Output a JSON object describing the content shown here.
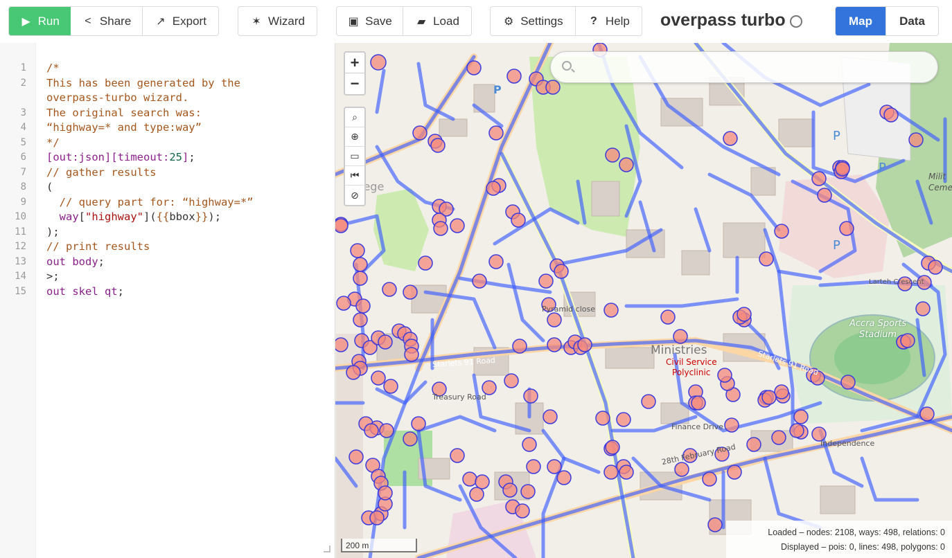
{
  "toolbar": {
    "run": "Run",
    "share": "Share",
    "export": "Export",
    "wizard": "Wizard",
    "save": "Save",
    "load": "Load",
    "settings": "Settings",
    "help": "Help",
    "map_tab": "Map",
    "data_tab": "Data"
  },
  "app_title": "overpass turbo",
  "editor": {
    "line_numbers": [
      "1",
      "2",
      "",
      "3",
      "4",
      "5",
      "6",
      "7",
      "8",
      "9",
      "10",
      "11",
      "12",
      "13",
      "14",
      "15"
    ]
  },
  "map": {
    "zoom_in": "+",
    "zoom_out": "−",
    "scale_label": "200 m",
    "stats_loaded": "Loaded – nodes: 2108, ways: 498, relations: 0",
    "stats_displayed": "Displayed – pois: 0, lines: 498, polygons: 0",
    "labels": {
      "starlets_91_road": "Starlets 91 Road",
      "starlets_91_road_2": "Starlets 91 Road",
      "pyramid_close": "Pyramid close",
      "treasury_road": "Treasury Road",
      "finance_drive": "Finance Drive",
      "february_road": "28th February Road",
      "ministries": "Ministries",
      "civil_service": "Civil Service",
      "polyclinic": "Polyclinic",
      "accra_sports": "Accra Sports",
      "stadium": "Stadium",
      "larteh_crescent": "Larteh Crescent",
      "independence": "Independence",
      "milit": "Milit",
      "ceme": "Ceme",
      "college": "lege"
    }
  },
  "colors": {
    "run_green": "#48c774",
    "active_blue": "#3273dc",
    "way_blue": "#3b5cff",
    "node_fill": "#f48a7d"
  }
}
